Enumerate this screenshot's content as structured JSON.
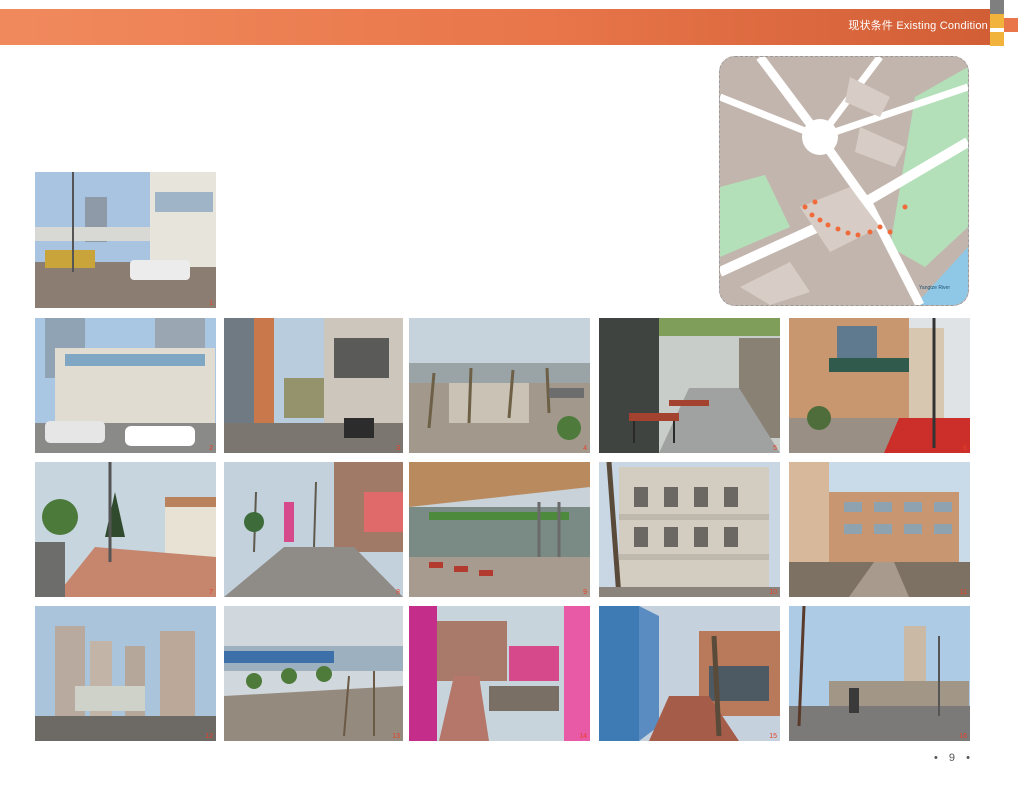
{
  "header": {
    "title_cn": "现状条件",
    "title_en": "Existing Condition",
    "accent_color": "#e8764a",
    "deco_colors": [
      "#7f7f7f",
      "#f2b33d",
      "#e8764a"
    ]
  },
  "map": {
    "labels": [
      "Yangtze River"
    ]
  },
  "photos": [
    {
      "number": "1"
    },
    {
      "number": "2"
    },
    {
      "number": "3"
    },
    {
      "number": "4"
    },
    {
      "number": "5"
    },
    {
      "number": "6"
    },
    {
      "number": "7"
    },
    {
      "number": "8"
    },
    {
      "number": "9"
    },
    {
      "number": "10"
    },
    {
      "number": "11"
    },
    {
      "number": "12"
    },
    {
      "number": "13"
    },
    {
      "number": "14"
    },
    {
      "number": "15"
    },
    {
      "number": "16"
    }
  ],
  "footer": {
    "page_number": "9"
  }
}
